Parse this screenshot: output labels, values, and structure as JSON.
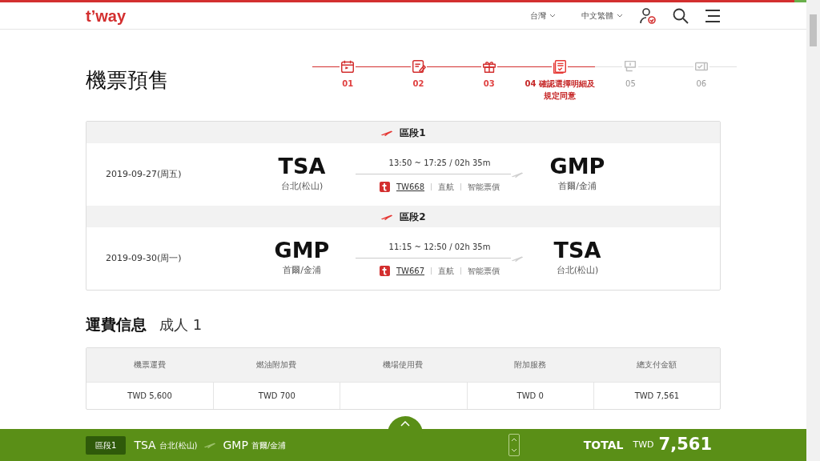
{
  "header": {
    "logo": "t’way",
    "region": "台灣",
    "language": "中文繁體"
  },
  "page_title": "機票預售",
  "steps": [
    {
      "label": "01",
      "completed": true,
      "selected": false
    },
    {
      "label": "02",
      "completed": true,
      "selected": false
    },
    {
      "label": "03",
      "completed": true,
      "selected": false
    },
    {
      "label": "04 確認選擇明細及規定同意",
      "completed": false,
      "selected": true
    },
    {
      "label": "05",
      "completed": false,
      "selected": false
    },
    {
      "label": "06",
      "completed": false,
      "selected": false
    }
  ],
  "segments": [
    {
      "title": "區段1",
      "date": "2019-09-27",
      "weekday": "(周五)",
      "from_code": "TSA",
      "from_city": "台北(松山)",
      "time": "13:50 ~ 17:25 / 02h 35m",
      "flight": "TW668",
      "type": "直航",
      "fare": "智能票價",
      "to_code": "GMP",
      "to_city": "首爾/金浦"
    },
    {
      "title": "區段2",
      "date": "2019-09-30",
      "weekday": "(周一)",
      "from_code": "GMP",
      "from_city": "首爾/金浦",
      "time": "11:15 ~ 12:50 / 02h 35m",
      "flight": "TW667",
      "type": "直航",
      "fare": "智能票價",
      "to_code": "TSA",
      "to_city": "台北(松山)"
    }
  ],
  "fare_info": {
    "title": "運費信息",
    "passengers": "成人 1"
  },
  "fare_table": {
    "columns": [
      {
        "header": "機票運費",
        "value": "TWD 5,600"
      },
      {
        "header": "燃油附加費",
        "value": "TWD 700"
      },
      {
        "header": "機場使用費"
      },
      {
        "header": "附加服務",
        "value": "TWD 0"
      },
      {
        "header": "總支付金額",
        "value": "TWD 7,561"
      }
    ]
  },
  "bottom_bar": {
    "segment": "區段1",
    "from_code": "TSA",
    "from_city": "台北(松山)",
    "to_code": "GMP",
    "to_city": "首爾/金浦",
    "total_label": "TOTAL",
    "currency": "TWD",
    "total": "7,561"
  }
}
